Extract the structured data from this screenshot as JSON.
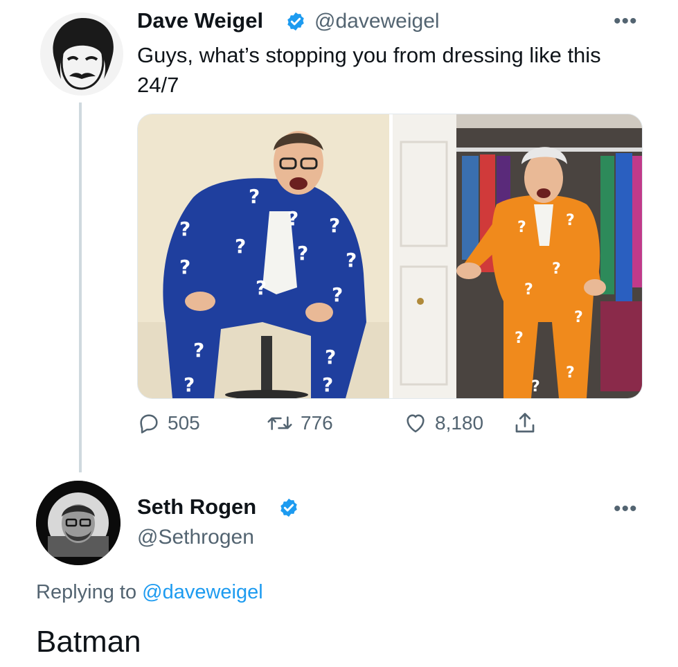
{
  "tweet": {
    "author_name": "Dave Weigel",
    "author_handle": "@daveweigel",
    "text": "Guys, what’s stopping you from dressing like this 24/7",
    "more_icon": "more-horizontal-icon",
    "media": [
      {
        "description_icon": "photo",
        "suit_color": "#1f3f9e",
        "backdrop_color": "#efe6cf"
      },
      {
        "description_icon": "photo",
        "suit_color": "#f08a1c",
        "backdrop_color": "#c9c3bb"
      }
    ],
    "stats": {
      "replies": "505",
      "retweets": "776",
      "likes": "8,180"
    }
  },
  "reply": {
    "author_name": "Seth Rogen",
    "author_handle": "@Sethrogen",
    "replying_prefix": "Replying to",
    "replying_to": "@daveweigel",
    "text": "Batman"
  },
  "colors": {
    "verified": "#1d9bf0",
    "link": "#1d9bf0",
    "secondary_text": "#536471"
  }
}
